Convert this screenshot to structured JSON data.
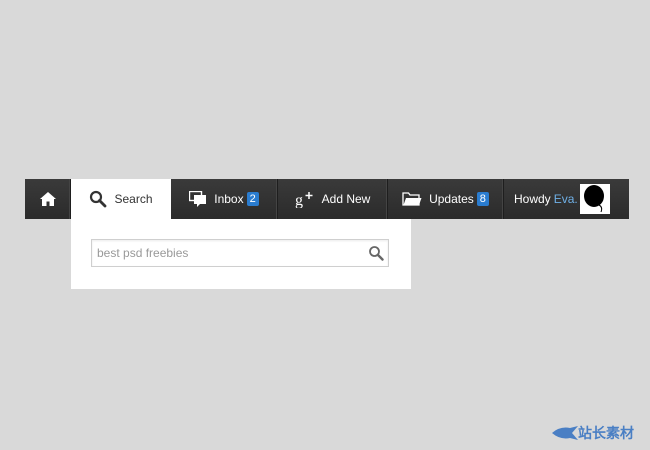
{
  "nav": {
    "home_icon": "home-icon",
    "search_label": "Search",
    "inbox_label": "Inbox",
    "inbox_count": "2",
    "add_label": "Add New",
    "updates_label": "Updates",
    "updates_count": "8",
    "howdy": "Howdy",
    "user_name": "Eva."
  },
  "search": {
    "value": "best psd freebies",
    "icon": "search-icon"
  },
  "watermark": {
    "text": "站长素材"
  },
  "colors": {
    "navbar": "#2f2f2f",
    "badge": "#2a7ccf",
    "user_name": "#6fb0e6",
    "background": "#d9d9d9"
  }
}
